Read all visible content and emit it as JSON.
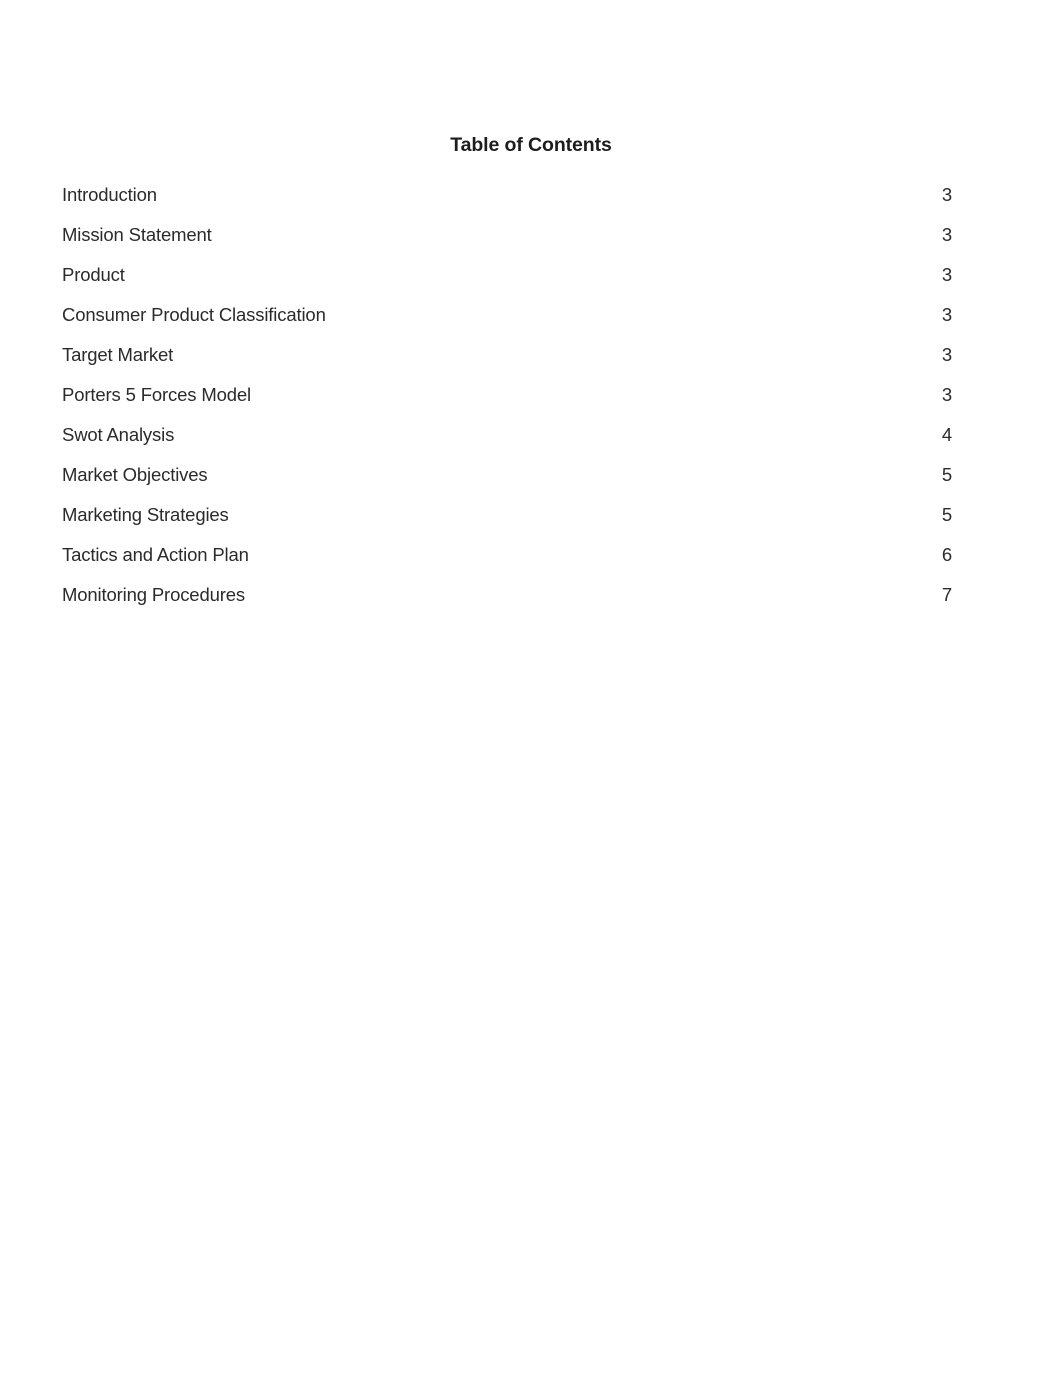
{
  "document": {
    "title": "Table of Contents",
    "background_color": "#ffffff",
    "text_color": "#2b2b2b"
  },
  "toc": {
    "entries": [
      {
        "title": "Introduction",
        "page": "3"
      },
      {
        "title": "Mission Statement",
        "page": "3"
      },
      {
        "title": "Product",
        "page": "3"
      },
      {
        "title": "Consumer Product Classification",
        "page": "3"
      },
      {
        "title": "Target Market",
        "page": "3"
      },
      {
        "title": "Porters 5 Forces Model",
        "page": "3"
      },
      {
        "title": "Swot Analysis",
        "page": "4"
      },
      {
        "title": "Market Objectives",
        "page": "5"
      },
      {
        "title": "Marketing Strategies",
        "page": "5"
      },
      {
        "title": "Tactics and Action Plan",
        "page": "6"
      },
      {
        "title": "Monitoring Procedures",
        "page": "7"
      }
    ]
  }
}
